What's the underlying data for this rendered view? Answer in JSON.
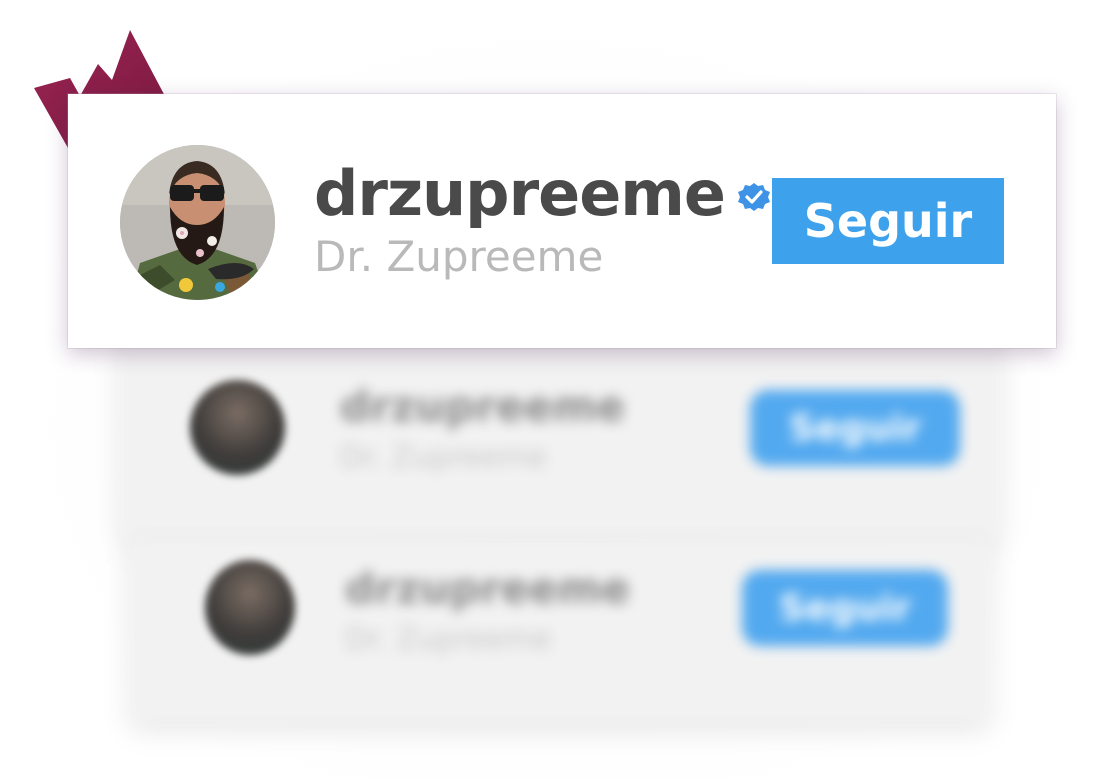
{
  "featured_profile": {
    "username": "drzupreeme",
    "full_name": "Dr. Zupreeme",
    "verified": true,
    "verified_icon": "verified-badge-icon",
    "follow_label": "Seguir"
  },
  "suggested_profiles": [
    {
      "username": "drzupreeme",
      "full_name": "Dr. Zupreeme",
      "follow_label": "Seguir"
    },
    {
      "username": "drzupreeme",
      "full_name": "Dr. Zupreeme",
      "follow_label": "Seguir"
    }
  ],
  "colors": {
    "accent_blue": "#3ea1ec",
    "crown": "#8e1f4c",
    "username_text": "#4a4a4a",
    "fullname_text": "#b9b9b9"
  }
}
